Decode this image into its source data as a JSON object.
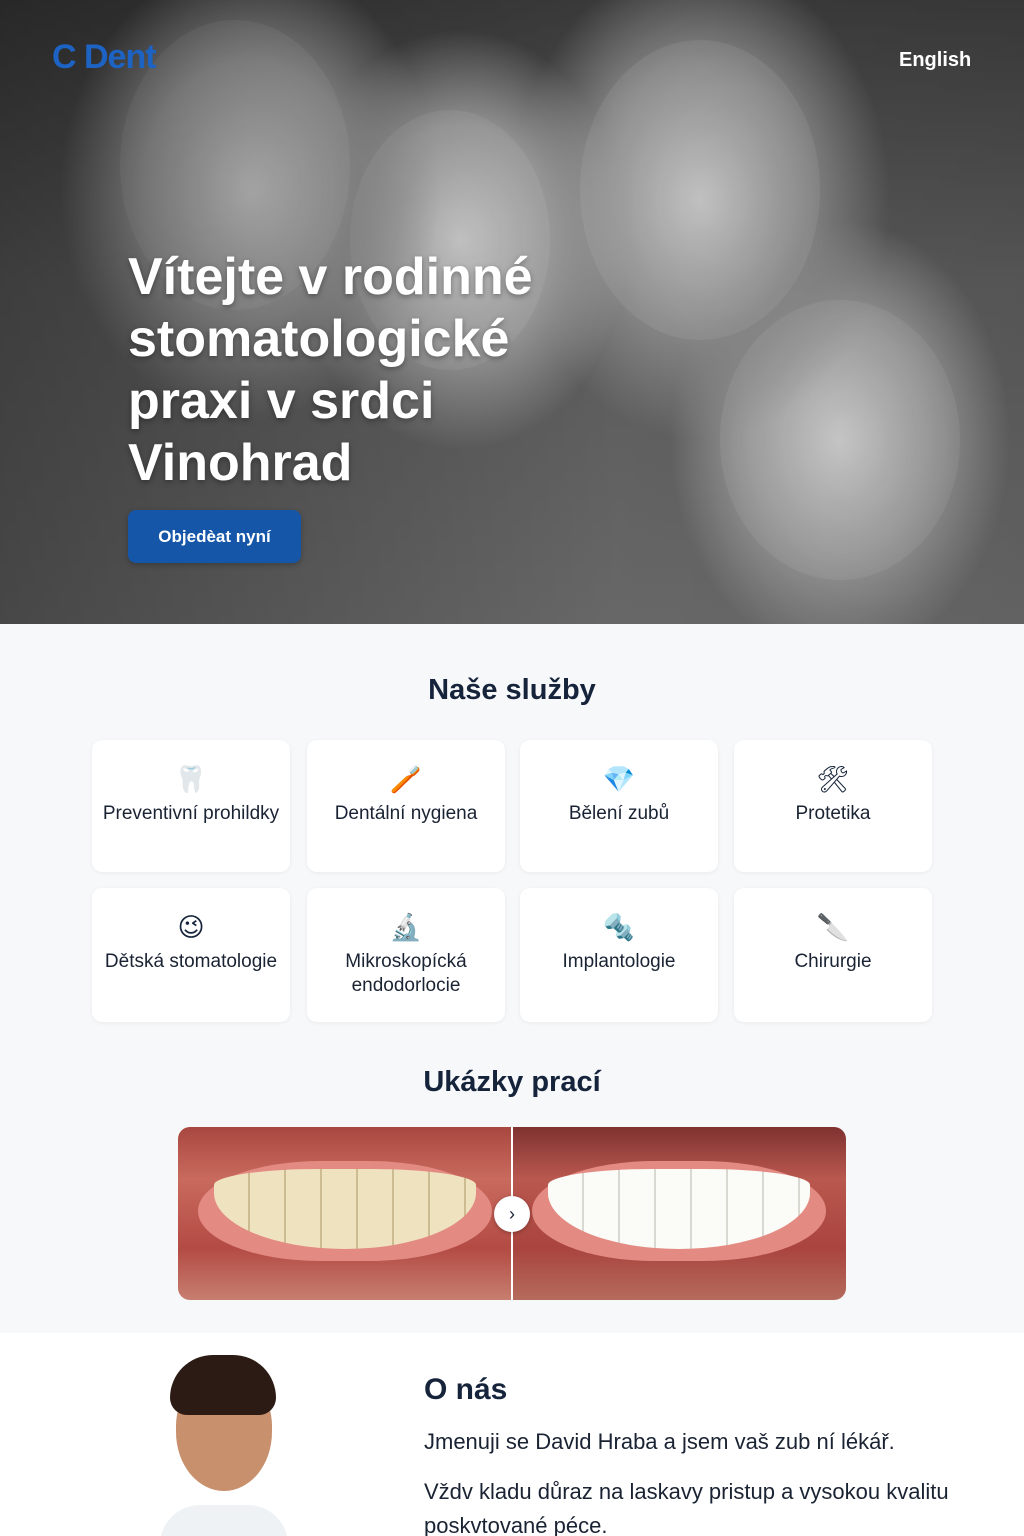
{
  "header": {
    "logo": "C Dent",
    "language_link": "English"
  },
  "hero": {
    "title": "Vítejte v rodinné stomatologické praxi v srdci Vinohrad",
    "cta_label": "Objedèat nyní"
  },
  "services": {
    "title": "Naše služby",
    "items": [
      {
        "icon": "tooth-icon",
        "glyph": "🦷",
        "label": "Preventivní prohildky"
      },
      {
        "icon": "toothbrush-icon",
        "glyph": "🪥",
        "label": "Dentální nygiena"
      },
      {
        "icon": "diamond-icon",
        "glyph": "💎",
        "label": "Bělení zubů"
      },
      {
        "icon": "tools-icon",
        "glyph": "🛠",
        "label": "Protetika"
      },
      {
        "icon": "smiley-icon",
        "glyph": "😉",
        "label": "Dětská stomatologie"
      },
      {
        "icon": "microscope-icon",
        "glyph": "🔬",
        "label": "Mikroskopícká endodorlocie"
      },
      {
        "icon": "implant-icon",
        "glyph": "🔩",
        "label": "Implantologie"
      },
      {
        "icon": "scalpel-icon",
        "glyph": "🔪",
        "label": "Chirurgie"
      }
    ]
  },
  "gallery": {
    "title": "Ukázky prací",
    "next_glyph": "›"
  },
  "about": {
    "title": "O nás",
    "paragraph1": "Jmenuji se David Hraba a jsem vaš zub ní lékář.",
    "paragraph2": "Vždv kladu důraz na laskavy pristup a vysokou kvalitu poskvtované péce."
  }
}
